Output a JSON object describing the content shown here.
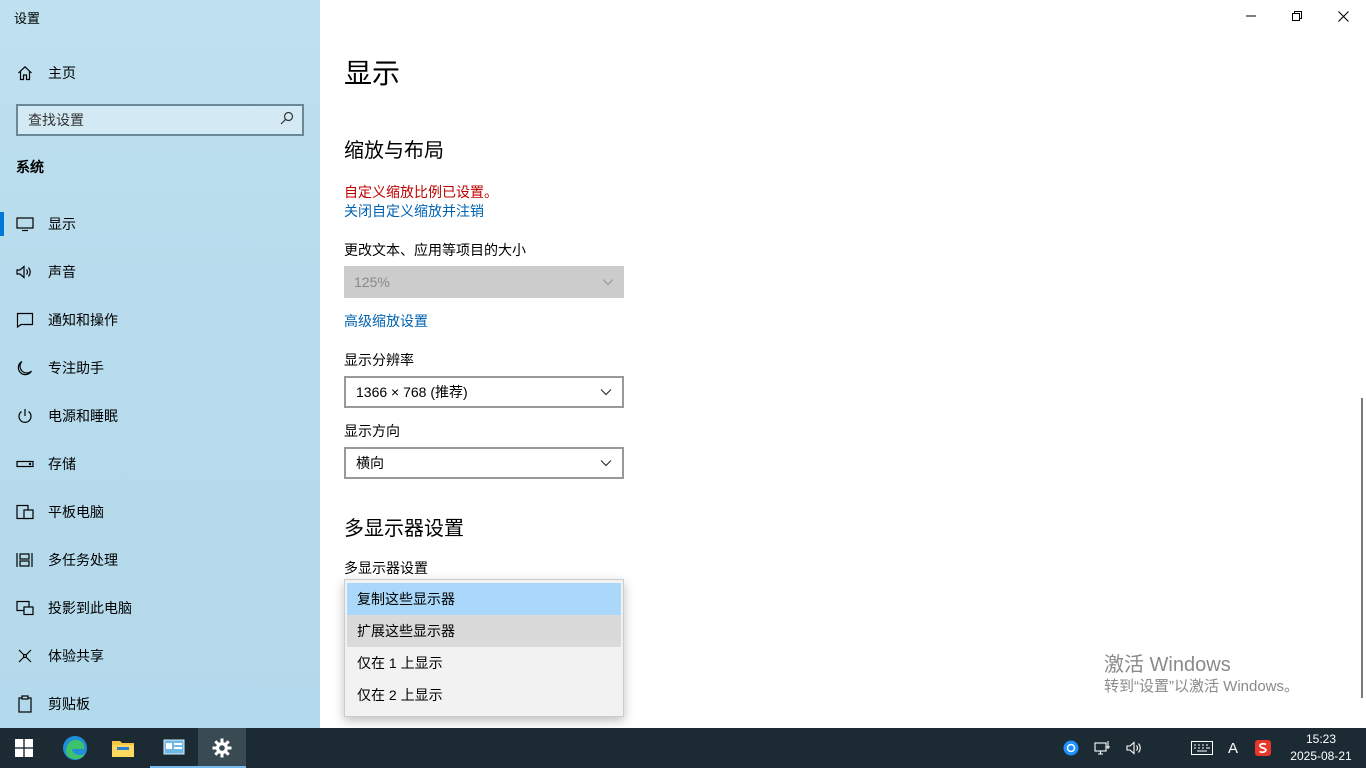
{
  "window": {
    "title": "设置"
  },
  "sidebar": {
    "home_label": "主页",
    "search_placeholder": "查找设置",
    "section_label": "系统",
    "items": [
      {
        "label": "显示",
        "icon": "monitor-icon",
        "active": true
      },
      {
        "label": "声音",
        "icon": "speaker-icon"
      },
      {
        "label": "通知和操作",
        "icon": "notification-icon"
      },
      {
        "label": "专注助手",
        "icon": "moon-icon"
      },
      {
        "label": "电源和睡眠",
        "icon": "power-icon"
      },
      {
        "label": "存储",
        "icon": "storage-icon"
      },
      {
        "label": "平板电脑",
        "icon": "tablet-icon"
      },
      {
        "label": "多任务处理",
        "icon": "multitask-icon"
      },
      {
        "label": "投影到此电脑",
        "icon": "project-icon"
      },
      {
        "label": "体验共享",
        "icon": "share-icon"
      },
      {
        "label": "剪贴板",
        "icon": "clipboard-icon"
      }
    ]
  },
  "main": {
    "title": "显示",
    "scale_section": "缩放与布局",
    "custom_scale_warning": "自定义缩放比例已设置。",
    "close_custom_scale_link": "关闭自定义缩放并注销",
    "text_size_label": "更改文本、应用等项目的大小",
    "text_size_value": "125%",
    "advanced_scaling_link": "高级缩放设置",
    "resolution_label": "显示分辨率",
    "resolution_value": "1366 × 768 (推荐)",
    "orientation_label": "显示方向",
    "orientation_value": "横向",
    "multi_section": "多显示器设置",
    "multi_label": "多显示器设置",
    "multi_options": [
      "复制这些显示器",
      "扩展这些显示器",
      "仅在 1 上显示",
      "仅在 2 上显示"
    ],
    "multi_selected": "复制这些显示器"
  },
  "watermark": {
    "line1": "激活 Windows",
    "line2": "转到“设置”以激活 Windows。"
  },
  "taskbar": {
    "apps": [
      "start-icon",
      "edge-icon",
      "file-explorer-icon",
      "control-panel-icon",
      "settings-icon"
    ],
    "tray": [
      "browser-tray-icon",
      "network-icon",
      "volume-icon",
      "keyboard-icon",
      "input-method-icon",
      "sogou-icon"
    ],
    "ime_label": "A",
    "time": "15:23",
    "date": "2025-08-21"
  },
  "colors": {
    "accent": "#0078d7",
    "link": "#0063b1",
    "warning": "#c00000",
    "selected_option": "#a9d8fa",
    "taskbar": "#1c2b33"
  }
}
